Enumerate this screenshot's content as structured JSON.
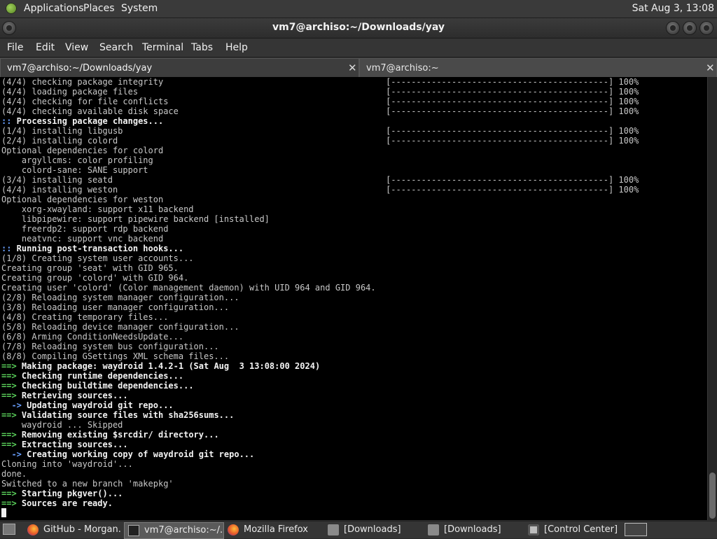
{
  "top_panel": {
    "menus": [
      "Applications",
      "Places",
      "System"
    ],
    "clock": "Sat Aug  3, 13:08"
  },
  "window": {
    "title": "vm7@archiso:~/Downloads/yay",
    "menubar": [
      "File",
      "Edit",
      "View",
      "Search",
      "Terminal",
      "Tabs",
      "Help"
    ],
    "tabs": [
      {
        "label": "vm7@archiso:~/Downloads/yay",
        "close": "✕",
        "active": true
      },
      {
        "label": "vm7@archiso:~",
        "close": "✕",
        "active": false
      }
    ]
  },
  "terminal": {
    "lines": [
      {
        "text": "(4/4) checking package integrity",
        "progress": "[-------------------------------------------] 100%"
      },
      {
        "text": "(4/4) loading package files",
        "progress": "[-------------------------------------------] 100%"
      },
      {
        "text": "(4/4) checking for file conflicts",
        "progress": "[-------------------------------------------] 100%"
      },
      {
        "text": "(4/4) checking available disk space",
        "progress": "[-------------------------------------------] 100%"
      },
      {
        "text": ":: Processing package changes...",
        "style": "bold",
        "prefix": "::"
      },
      {
        "text": "(1/4) installing libgusb",
        "progress": "[-------------------------------------------] 100%"
      },
      {
        "text": "(2/4) installing colord",
        "progress": "[-------------------------------------------] 100%"
      },
      {
        "text": "Optional dependencies for colord"
      },
      {
        "text": "    argyllcms: color profiling"
      },
      {
        "text": "    colord-sane: SANE support"
      },
      {
        "text": "(3/4) installing seatd",
        "progress": "[-------------------------------------------] 100%"
      },
      {
        "text": "(4/4) installing weston",
        "progress": "[-------------------------------------------] 100%"
      },
      {
        "text": "Optional dependencies for weston"
      },
      {
        "text": "    xorg-xwayland: support x11 backend"
      },
      {
        "text": "    libpipewire: support pipewire backend [installed]"
      },
      {
        "text": "    freerdp2: support rdp backend"
      },
      {
        "text": "    neatvnc: support vnc backend"
      },
      {
        "text": ":: Running post-transaction hooks...",
        "style": "bold",
        "prefix": "::"
      },
      {
        "text": "(1/8) Creating system user accounts..."
      },
      {
        "text": "Creating group 'seat' with GID 965."
      },
      {
        "text": "Creating group 'colord' with GID 964."
      },
      {
        "text": "Creating user 'colord' (Color management daemon) with UID 964 and GID 964."
      },
      {
        "text": "(2/8) Reloading system manager configuration..."
      },
      {
        "text": "(3/8) Reloading user manager configuration..."
      },
      {
        "text": "(4/8) Creating temporary files..."
      },
      {
        "text": "(5/8) Reloading device manager configuration..."
      },
      {
        "text": "(6/8) Arming ConditionNeedsUpdate..."
      },
      {
        "text": "(7/8) Reloading system bus configuration..."
      },
      {
        "text": "(8/8) Compiling GSettings XML schema files..."
      },
      {
        "text": "==> Making package: waydroid 1.4.2-1 (Sat Aug  3 13:08:00 2024)",
        "style": "bold",
        "prefix": "==>"
      },
      {
        "text": "==> Checking runtime dependencies...",
        "style": "bold",
        "prefix": "==>"
      },
      {
        "text": "==> Checking buildtime dependencies...",
        "style": "bold",
        "prefix": "==>"
      },
      {
        "text": "==> Retrieving sources...",
        "style": "bold",
        "prefix": "==>"
      },
      {
        "text": "  -> Updating waydroid git repo...",
        "style": "bold",
        "prefix": "  ->"
      },
      {
        "text": "==> Validating source files with sha256sums...",
        "style": "bold",
        "prefix": "==>"
      },
      {
        "text": "    waydroid ... Skipped"
      },
      {
        "text": "==> Removing existing $srcdir/ directory...",
        "style": "bold",
        "prefix": "==>"
      },
      {
        "text": "==> Extracting sources...",
        "style": "bold",
        "prefix": "==>"
      },
      {
        "text": "  -> Creating working copy of waydroid git repo...",
        "style": "bold",
        "prefix": "  ->"
      },
      {
        "text": "Cloning into 'waydroid'..."
      },
      {
        "text": "done."
      },
      {
        "text": "Switched to a new branch 'makepkg'"
      },
      {
        "text": "==> Starting pkgver()...",
        "style": "bold",
        "prefix": "==>"
      },
      {
        "text": "==> Sources are ready.",
        "style": "bold",
        "prefix": "==>"
      }
    ]
  },
  "taskbar": {
    "items": [
      {
        "icon": "firefox-icon",
        "label": "GitHub - Morgan...",
        "active": false
      },
      {
        "icon": "terminal-icon",
        "label": "vm7@archiso:~/...",
        "active": true
      },
      {
        "icon": "firefox-icon",
        "label": "Mozilla Firefox",
        "active": false
      },
      {
        "icon": "folder-icon",
        "label": "[Downloads]",
        "active": false
      },
      {
        "icon": "folder-icon",
        "label": "[Downloads]",
        "active": false
      },
      {
        "icon": "control-center-icon",
        "label": "[Control Center]",
        "active": false
      }
    ]
  },
  "colors": {
    "terminal_bg": "#000000",
    "prompt_green": "#5ad05a",
    "arrow_blue": "#6aa0ff",
    "panel_bg": "#3a3a3a"
  }
}
